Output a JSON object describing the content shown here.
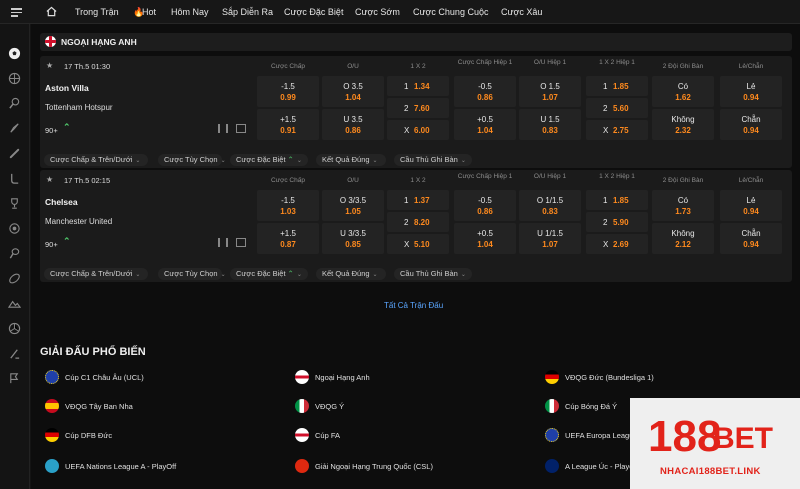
{
  "nav": {
    "items": [
      "Trong Trận",
      "Hot",
      "Hôm Nay",
      "Sắp Diễn Ra",
      "Cược Đặc Biệt",
      "Cược Sớm",
      "Cược Chung Cuộc",
      "Cược Xâu"
    ]
  },
  "league": {
    "title": "NGOẠI HẠNG ANH"
  },
  "headers": {
    "handicap": "Cược Chấp",
    "ou": "O/U",
    "x12": "1 X 2",
    "handicap_h1": "Cược Chấp Hiệp 1",
    "ou_h1": "O/U Hiệp 1",
    "x12_h1": "1 X 2 Hiệp 1",
    "btts": "2 Đội Ghi Bàn",
    "oe": "Lẻ/Chẵn"
  },
  "matches": [
    {
      "time": "17 Th.5 01:30",
      "home": "Aston Villa",
      "away": "Tottenham Hotspur",
      "minute": "90+",
      "hc": [
        {
          "l": "-1.5",
          "o": "0.99"
        },
        {
          "l": "+1.5",
          "o": "0.91"
        }
      ],
      "ou": [
        {
          "l": "O 3.5",
          "o": "1.04"
        },
        {
          "l": "U 3.5",
          "o": "0.86"
        }
      ],
      "x12": [
        {
          "l": "1",
          "o": "1.34"
        },
        {
          "l": "2",
          "o": "7.60"
        },
        {
          "l": "X",
          "o": "6.00"
        }
      ],
      "hc1": [
        {
          "l": "-0.5",
          "o": "0.86"
        },
        {
          "l": "+0.5",
          "o": "1.04"
        }
      ],
      "ou1": [
        {
          "l": "O 1.5",
          "o": "1.07"
        },
        {
          "l": "U 1.5",
          "o": "0.83"
        }
      ],
      "x121": [
        {
          "l": "1",
          "o": "1.85"
        },
        {
          "l": "2",
          "o": "5.60"
        },
        {
          "l": "X",
          "o": "2.75"
        }
      ],
      "btts": [
        {
          "l": "Có",
          "o": "1.62"
        },
        {
          "l": "Không",
          "o": "2.32"
        }
      ],
      "oe": [
        {
          "l": "Lẻ",
          "o": "0.94"
        },
        {
          "l": "Chẵn",
          "o": "0.94"
        }
      ]
    },
    {
      "time": "17 Th.5 02:15",
      "home": "Chelsea",
      "away": "Manchester United",
      "minute": "90+",
      "hc": [
        {
          "l": "-1.5",
          "o": "1.03"
        },
        {
          "l": "+1.5",
          "o": "0.87"
        }
      ],
      "ou": [
        {
          "l": "O 3/3.5",
          "o": "1.05"
        },
        {
          "l": "U 3/3.5",
          "o": "0.85"
        }
      ],
      "x12": [
        {
          "l": "1",
          "o": "1.37"
        },
        {
          "l": "2",
          "o": "8.20"
        },
        {
          "l": "X",
          "o": "5.10"
        }
      ],
      "hc1": [
        {
          "l": "-0.5",
          "o": "0.86"
        },
        {
          "l": "+0.5",
          "o": "1.04"
        }
      ],
      "ou1": [
        {
          "l": "O 1/1.5",
          "o": "0.83"
        },
        {
          "l": "U 1/1.5",
          "o": "1.07"
        }
      ],
      "x121": [
        {
          "l": "1",
          "o": "1.85"
        },
        {
          "l": "2",
          "o": "5.90"
        },
        {
          "l": "X",
          "o": "2.69"
        }
      ],
      "btts": [
        {
          "l": "Có",
          "o": "1.73"
        },
        {
          "l": "Không",
          "o": "2.12"
        }
      ],
      "oe": [
        {
          "l": "Lẻ",
          "o": "0.94"
        },
        {
          "l": "Chẵn",
          "o": "0.94"
        }
      ]
    }
  ],
  "tabs": [
    "Cược Chấp & Trên/Dưới",
    "Cược Tùy Chọn",
    "Cược Đặc Biệt",
    "Kết Quả Đúng",
    "Cầu Thủ Ghi Bàn"
  ],
  "all_matches": "Tất Cả Trận Đấu",
  "popular": {
    "title": "GIẢI ĐẤU PHỔ BIẾN",
    "items": [
      "Cúp C1 Châu Âu (UCL)",
      "Ngoại Hạng Anh",
      "VĐQG Đức (Bundesliga 1)",
      "VĐQG Tây Ban Nha",
      "VĐQG Ý",
      "Cúp Bóng Đá Ý",
      "Cúp DFB Đức",
      "Cúp FA",
      "UEFA Europa League",
      "UEFA Nations League A - PlayOff",
      "Giải Ngoại Hạng Trung Quốc (CSL)",
      "A League Úc - Playoff"
    ]
  },
  "logo": {
    "text1": "188",
    "text2": "BET",
    "sub": "NHACAI188BET.LINK"
  },
  "colors": {
    "odds": "#ff8a1e",
    "accent": "#4fc76a",
    "logo_red": "#e2231a"
  }
}
